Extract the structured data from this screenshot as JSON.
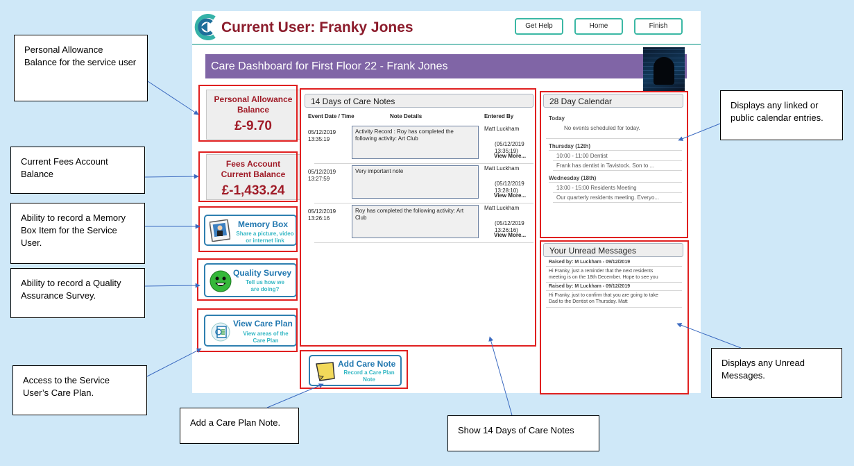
{
  "header": {
    "user_title": "Current User: Franky Jones",
    "buttons": {
      "help": "Get Help",
      "home": "Home",
      "finish": "Finish"
    }
  },
  "dashboard": {
    "title": "Care Dashboard for First Floor 22 - Frank Jones"
  },
  "balances": {
    "personal_allowance": {
      "label_line1": "Personal Allowance",
      "label_line2": "Balance",
      "value": "£-9.70"
    },
    "fees_account": {
      "label_line1": "Fees Account",
      "label_line2": "Current Balance",
      "value": "£-1,433.24"
    }
  },
  "tiles": {
    "memory_box": {
      "title": "Memory Box",
      "sub": "Share a picture, video or internet link"
    },
    "quality_survey": {
      "title": "Quality Survey",
      "sub_line1": "Tell us how we",
      "sub_line2": "are doing?"
    },
    "care_plan": {
      "title": "View Care Plan",
      "sub_line1": "View areas of the",
      "sub_line2": "Care Plan"
    },
    "add_care_note": {
      "title": "Add Care Note",
      "sub_line1": "Record a Care Plan",
      "sub_line2": "Note"
    }
  },
  "care_notes": {
    "title": "14 Days of Care Notes",
    "col_date": "Event Date / Time",
    "col_details": "Note Details",
    "col_entered": "Entered By",
    "rows": [
      {
        "date": "05/12/2019",
        "time": "13:35:19",
        "details": "Activity Record : Roy has completed the following activity: Art Club",
        "by": "Matt Luckham",
        "at_line1": "(05/12/2019",
        "at_line2": "13:35:19)",
        "more": "View More..."
      },
      {
        "date": "05/12/2019",
        "time": "13:27:59",
        "details": "Very important note",
        "by": "Matt Luckham",
        "at_line1": "(05/12/2019",
        "at_line2": "13:28:10)",
        "more": "View More..."
      },
      {
        "date": "05/12/2019",
        "time": "13:26:16",
        "details": "Roy has completed the following activity: Art Club",
        "by": "Matt Luckham",
        "at_line1": "(05/12/2019",
        "at_line2": "13:26:16)",
        "more": "View More..."
      }
    ]
  },
  "calendar": {
    "title": "28 Day Calendar",
    "today_label": "Today",
    "today_text": "No events scheduled for today.",
    "days": [
      {
        "day": "Thursday (12th)",
        "time": "10:00 - 11:00 Dentist",
        "desc": "Frank has dentist in Tavistock.  Son to ..."
      },
      {
        "day": "Wednesday (18th)",
        "time": "13:00 - 15:00 Residents Meeting",
        "desc": "Our quarterly residents meeting.  Everyo..."
      }
    ]
  },
  "messages": {
    "title": "Your Unread Messages",
    "items": [
      {
        "from": "Raised by: M Luckham - 09/12/2019",
        "line1": "Hi Franky, just a reminder that the next residents",
        "line2": "meeting is on the 18th December.  Hope to see you"
      },
      {
        "from": "Raised by: M Luckham - 09/12/2019",
        "line1": "Hi Franky, just to confirm that you are going to take",
        "line2": "Dad to the Dentist on Thursday.  Matt"
      }
    ]
  },
  "callouts": {
    "personal_allowance": "Personal Allowance Balance for the service user",
    "fees": "Current Fees Account Balance",
    "memory_box": "Ability to record a Memory Box Item for the Service User.",
    "quality": "Ability to record a Quality Assurance Survey.",
    "care_plan": "Access to the Service User’s Care Plan.",
    "add_note": "Add a Care Plan Note.",
    "care_notes": "Show 14 Days of Care Notes",
    "calendar": "Displays any linked or public calendar entries.",
    "messages": "Displays any Unread Messages."
  },
  "colors": {
    "background": "#cfe8f8",
    "banner": "#8065a6",
    "title_red": "#8c1c2c",
    "annotation_red": "#e02020",
    "tile_blue": "#2278b0",
    "tile_teal": "#33b7c4",
    "button_border": "#3bb8a4"
  }
}
